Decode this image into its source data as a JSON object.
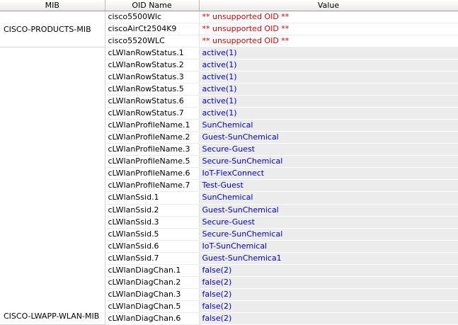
{
  "headers": {
    "mib": "MIB",
    "oid_name": "OID Name",
    "value": "Value"
  },
  "colors": {
    "value_text": "#0000cc",
    "unsupported_text": "#e00000",
    "cell_background": "#ececec"
  },
  "groups": [
    {
      "mib": "CISCO-PRODUCTS-MIB",
      "rows": [
        {
          "oid": "cisco5500Wlc",
          "value": "** unsupported OID **",
          "unsupported": true
        },
        {
          "oid": "ciscoAirCt2504K9",
          "value": "** unsupported OID **",
          "unsupported": true
        },
        {
          "oid": "cisco5520WLC",
          "value": "** unsupported OID **",
          "unsupported": true
        }
      ]
    },
    {
      "mib": "CISCO-LWAPP-WLAN-MIB",
      "rows": [
        {
          "oid": "cLWlanRowStatus.1",
          "value": "active(1)"
        },
        {
          "oid": "cLWlanRowStatus.2",
          "value": "active(1)"
        },
        {
          "oid": "cLWlanRowStatus.3",
          "value": "active(1)"
        },
        {
          "oid": "cLWlanRowStatus.5",
          "value": "active(1)"
        },
        {
          "oid": "cLWlanRowStatus.6",
          "value": "active(1)"
        },
        {
          "oid": "cLWlanRowStatus.7",
          "value": "active(1)"
        },
        {
          "oid": "cLWlanProfileName.1",
          "value": "SunChemical"
        },
        {
          "oid": "cLWlanProfileName.2",
          "value": "Guest-SunChemical"
        },
        {
          "oid": "cLWlanProfileName.3",
          "value": "Secure-Guest"
        },
        {
          "oid": "cLWlanProfileName.5",
          "value": "Secure-SunChemical"
        },
        {
          "oid": "cLWlanProfileName.6",
          "value": "IoT-FlexConnect"
        },
        {
          "oid": "cLWlanProfileName.7",
          "value": "Test-Guest"
        },
        {
          "oid": "cLWlanSsid.1",
          "value": "SunChemical"
        },
        {
          "oid": "cLWlanSsid.2",
          "value": "Guest-SunChemical"
        },
        {
          "oid": "cLWlanSsid.3",
          "value": "Secure-Guest"
        },
        {
          "oid": "cLWlanSsid.5",
          "value": "Secure-SunChemical"
        },
        {
          "oid": "cLWlanSsid.6",
          "value": "IoT-SunChemical"
        },
        {
          "oid": "cLWlanSsid.7",
          "value": "Guest-SunChemica1"
        },
        {
          "oid": "cLWlanDiagChan.1",
          "value": "false(2)"
        },
        {
          "oid": "cLWlanDiagChan.2",
          "value": "false(2)"
        },
        {
          "oid": "cLWlanDiagChan.3",
          "value": "false(2)"
        },
        {
          "oid": "cLWlanDiagChan.5",
          "value": "false(2)"
        },
        {
          "oid": "cLWlanDiagChan.6",
          "value": "false(2)"
        }
      ]
    }
  ]
}
